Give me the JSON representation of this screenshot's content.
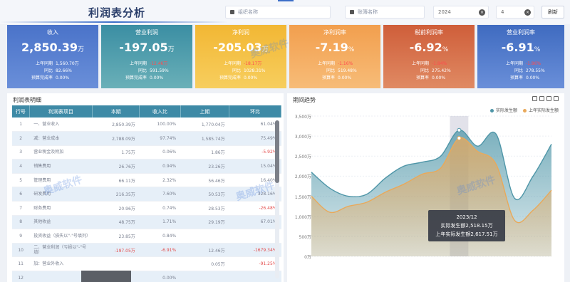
{
  "header": {
    "title": "利润表分析",
    "filters": [
      {
        "label": "组织名称"
      },
      {
        "label": "账簿名称"
      }
    ],
    "year": "2024",
    "month": "4",
    "clear_icon": "×",
    "refresh_label": "刷新"
  },
  "kpis": [
    {
      "title": "收入",
      "value": "2,850.39",
      "unit": "万",
      "rows": [
        [
          "上年同期",
          "1,560.70万",
          false
        ],
        [
          "同比",
          "82.66%",
          false
        ],
        [
          "预算完成率",
          "0.00%",
          false
        ]
      ]
    },
    {
      "title": "营业利润",
      "value": "-197.05",
      "unit": "万",
      "rows": [
        [
          "上年同期",
          "-12.46万",
          true
        ],
        [
          "同比",
          "591.59%",
          false
        ],
        [
          "预算完成率",
          "0.00%",
          false
        ]
      ]
    },
    {
      "title": "净利润",
      "value": "-205.03",
      "unit": "万",
      "rows": [
        [
          "上年同期",
          "-18.17万",
          true
        ],
        [
          "同比",
          "1028.31%",
          false
        ],
        [
          "预算完成率",
          "0.00%",
          false
        ]
      ]
    },
    {
      "title": "净利润率",
      "value": "-7.19",
      "unit": "%",
      "rows": [
        [
          "上年同期",
          "-1.16%",
          true
        ],
        [
          "同比",
          "519.48%",
          false
        ],
        [
          "预算率",
          "0.00%",
          false
        ]
      ]
    },
    {
      "title": "税前利润率",
      "value": "-6.92",
      "unit": "%",
      "rows": [
        [
          "上年同期",
          "-1.84%",
          true
        ],
        [
          "同比",
          "275.42%",
          false
        ],
        [
          "预算率",
          "0.00%",
          false
        ]
      ]
    },
    {
      "title": "营业利润率",
      "value": "-6.91",
      "unit": "%",
      "rows": [
        [
          "上年同期",
          "-1.86%",
          true
        ],
        [
          "同比",
          "278.55%",
          false
        ],
        [
          "预算率",
          "0.00%",
          false
        ]
      ]
    }
  ],
  "table": {
    "title": "利润表明细",
    "headers": [
      "行号",
      "利润表项目",
      "本期",
      "收入比",
      "上期",
      "环比"
    ],
    "rows": [
      [
        "1",
        "一、营业收入",
        "2,850.39万",
        "100.00%",
        "1,770.04万",
        "61.04%"
      ],
      [
        "2",
        "减：营业成本",
        "2,788.09万",
        "97.74%",
        "1,585.74万",
        "75.49%"
      ],
      [
        "3",
        "营业税金及附加",
        "1.75万",
        "0.06%",
        "1.86万",
        "-5.92%"
      ],
      [
        "4",
        "销售费用",
        "26.76万",
        "0.94%",
        "23.26万",
        "15.04%"
      ],
      [
        "5",
        "管理费用",
        "66.11万",
        "2.32%",
        "56.46万",
        "16.40%"
      ],
      [
        "6",
        "研发费用",
        "216.35万",
        "7.60%",
        "50.53万",
        "328.16%"
      ],
      [
        "7",
        "财务费用",
        "20.96万",
        "0.74%",
        "28.53万",
        "-26.48%"
      ],
      [
        "8",
        "其他收益",
        "48.75万",
        "1.71%",
        "29.19万",
        "67.01%"
      ],
      [
        "9",
        "投资收益（损失以\"-\"号填列）",
        "23.85万",
        "0.84%",
        "",
        ""
      ],
      [
        "10",
        "二、营业利润（亏损以\"-\"号填）",
        "-197.05万",
        "-6.91%",
        "12.46万",
        "-1679.34%"
      ],
      [
        "11",
        "加：营业外收入",
        "",
        "",
        "0.05万",
        "-91.25%"
      ],
      [
        "12",
        "",
        "",
        "0.00%",
        "",
        ""
      ]
    ]
  },
  "trend": {
    "title": "期间趋势",
    "legend": [
      "实际发生额",
      "上年实际发生额"
    ],
    "tooltip": {
      "period": "2023/12",
      "current": "实际发生额2,518.15万",
      "previous": "上年实际发生额2,617.51万"
    }
  },
  "chart_data": {
    "type": "area",
    "yticks": [
      "3,500万",
      "3,000万",
      "2,500万",
      "2,000万",
      "1,500万",
      "1,000万",
      "500万",
      "0万"
    ],
    "ylim": [
      0,
      3500
    ],
    "series": [
      {
        "name": "实际发生额",
        "color": "#4f96a8",
        "values": [
          2100,
          1700,
          1500,
          1550,
          1950,
          2250,
          2350,
          2500,
          3150,
          2750,
          3050,
          1450,
          2000,
          2800
        ]
      },
      {
        "name": "上年实际发生额",
        "color": "#e9a95a",
        "values": [
          1500,
          1100,
          1250,
          1350,
          1600,
          1800,
          2050,
          2200,
          2950,
          2620,
          2300,
          900,
          1150,
          1650
        ]
      }
    ],
    "highlight_index": 8
  },
  "watermark": "奥威软件"
}
